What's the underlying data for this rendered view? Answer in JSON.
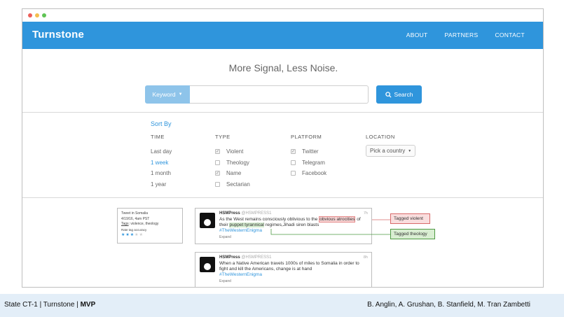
{
  "navbar": {
    "brand": "Turnstone",
    "links": [
      "ABOUT",
      "PARTNERS",
      "CONTACT"
    ]
  },
  "hero": {
    "tagline": "More Signal, Less Noise.",
    "keyword_label": "Keyword",
    "search_value": "",
    "search_button": "Search"
  },
  "filters": {
    "sort_by": "Sort By",
    "time": {
      "header": "TIME",
      "options": [
        "Last day",
        "1 week",
        "1 month",
        "1 year"
      ],
      "selected": "1 week"
    },
    "type": {
      "header": "TYPE",
      "options": [
        {
          "label": "Violent",
          "checked": true
        },
        {
          "label": "Theology",
          "checked": false
        },
        {
          "label": "Name",
          "checked": true
        },
        {
          "label": "Sectarian",
          "checked": false
        }
      ]
    },
    "platform": {
      "header": "PLATFORM",
      "options": [
        {
          "label": "Twitter",
          "checked": true
        },
        {
          "label": "Telegram",
          "checked": false
        },
        {
          "label": "Facebook",
          "checked": false
        }
      ]
    },
    "location": {
      "header": "LOCATION",
      "select_value": "Pick a country"
    }
  },
  "info_card": {
    "title": "Tweet in Somalia",
    "date": "4/19/16, 4am PST",
    "tags_label": "Tags",
    "tags": "violence, theology",
    "accuracy_label": "Rate tag accuracy",
    "rating": 3,
    "rating_max": 5
  },
  "tweets": [
    {
      "name": "HSMPress",
      "handle": "@HSMPRESS1",
      "time": "7h",
      "text_a": "As the West remains consciously oblivious to the ",
      "hl_violent": "obvious atrocities",
      "text_b": " of their ",
      "hl_theology": "puppet tyrannical",
      "text_c": " regimes,Jihadi siren blasts",
      "hashtag": "#TheWesternEnigma",
      "expand": "Expand"
    },
    {
      "name": "HSMPress",
      "handle": "@HSMPRESS1",
      "time": "8h",
      "text": "When a Native American travels 1000s of miles to Somalia in order to fight and kill the Americans, change is at hand",
      "hashtag": "#TheWesternEnigma",
      "expand": "Expand"
    }
  ],
  "tags": {
    "violent": "Tagged violent",
    "theology": "Tagged theology"
  },
  "footer": {
    "left_a": "State CT-1 | Turnstone | ",
    "left_b": "MVP",
    "right": "B. Anglin, A. Grushan, B. Stanfield, M. Tran Zambetti"
  },
  "colors": {
    "brand_blue": "#2f95dc",
    "tag_red": "#d86a6a",
    "tag_green": "#4f9a44"
  }
}
